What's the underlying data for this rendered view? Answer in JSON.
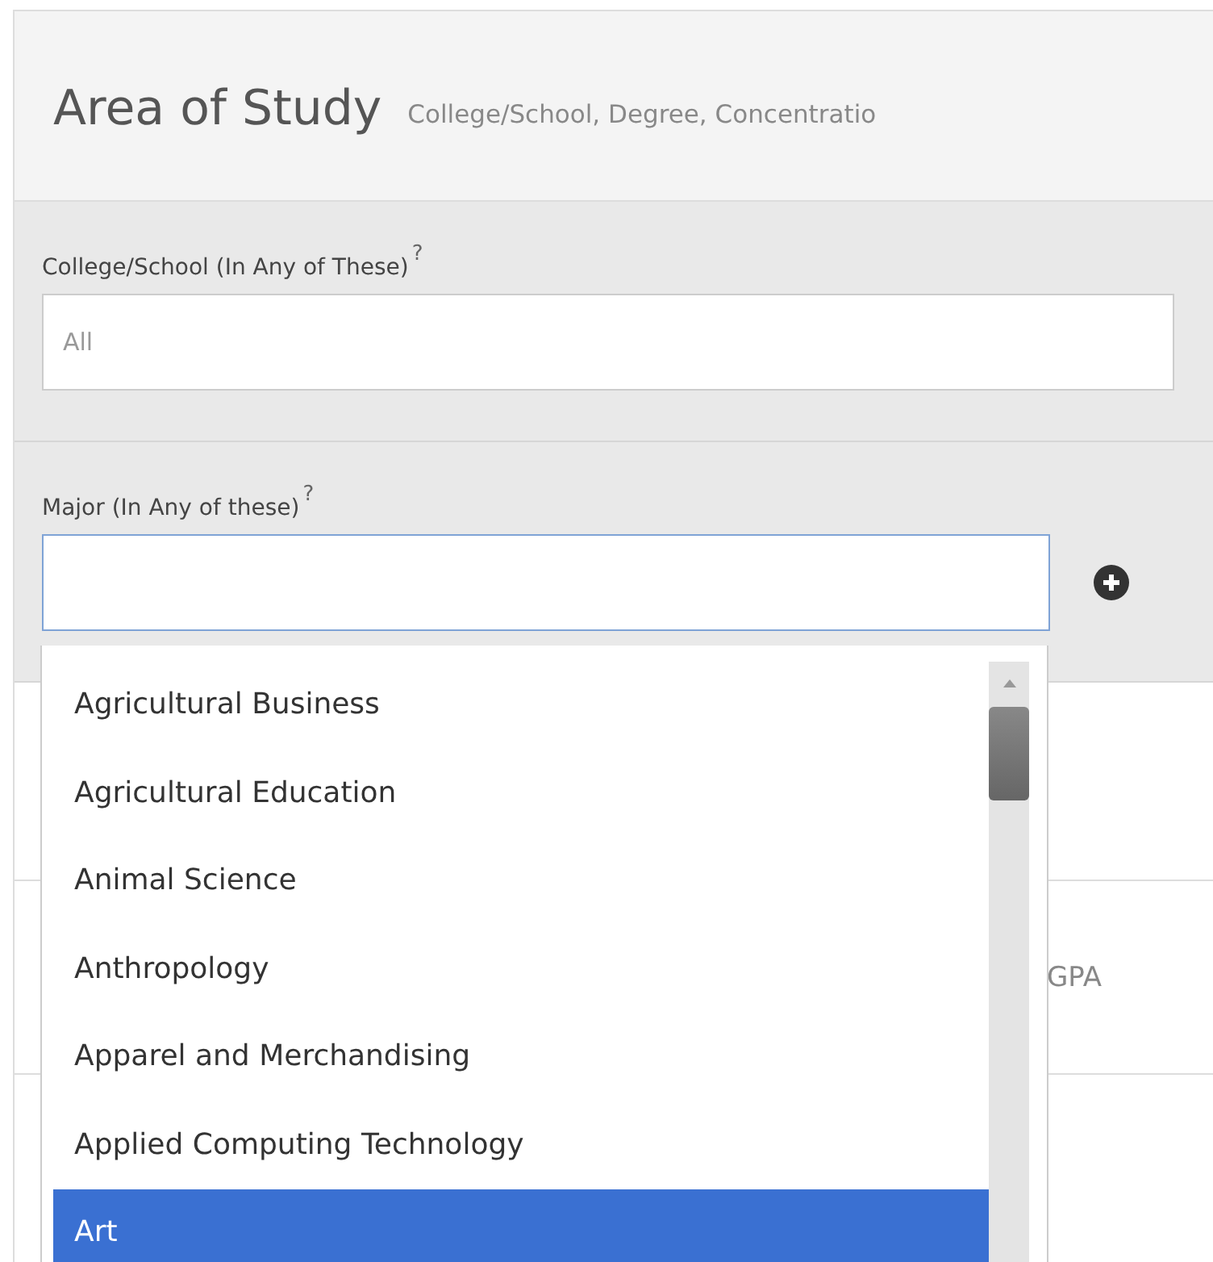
{
  "panel": {
    "title": "Area of Study",
    "subtitle": "College/School, Degree, Concentratio"
  },
  "fields": [
    {
      "label": "College/School (In Any of These)",
      "help": "?",
      "placeholder": "All",
      "focused": false,
      "add_button": false
    },
    {
      "label": "Major (In Any of these)",
      "help": "?",
      "focused": true,
      "add_button": true
    }
  ],
  "gpa_label": "GPA",
  "dropdown": {
    "items": [
      {
        "label": "Agricultural Business",
        "selected": false
      },
      {
        "label": "Agricultural Education",
        "selected": false
      },
      {
        "label": "Animal Science",
        "selected": false
      },
      {
        "label": "Anthropology",
        "selected": false
      },
      {
        "label": "Apparel and Merchandising",
        "selected": false
      },
      {
        "label": "Applied Computing Technology",
        "selected": false
      },
      {
        "label": "Art",
        "selected": true
      }
    ]
  }
}
